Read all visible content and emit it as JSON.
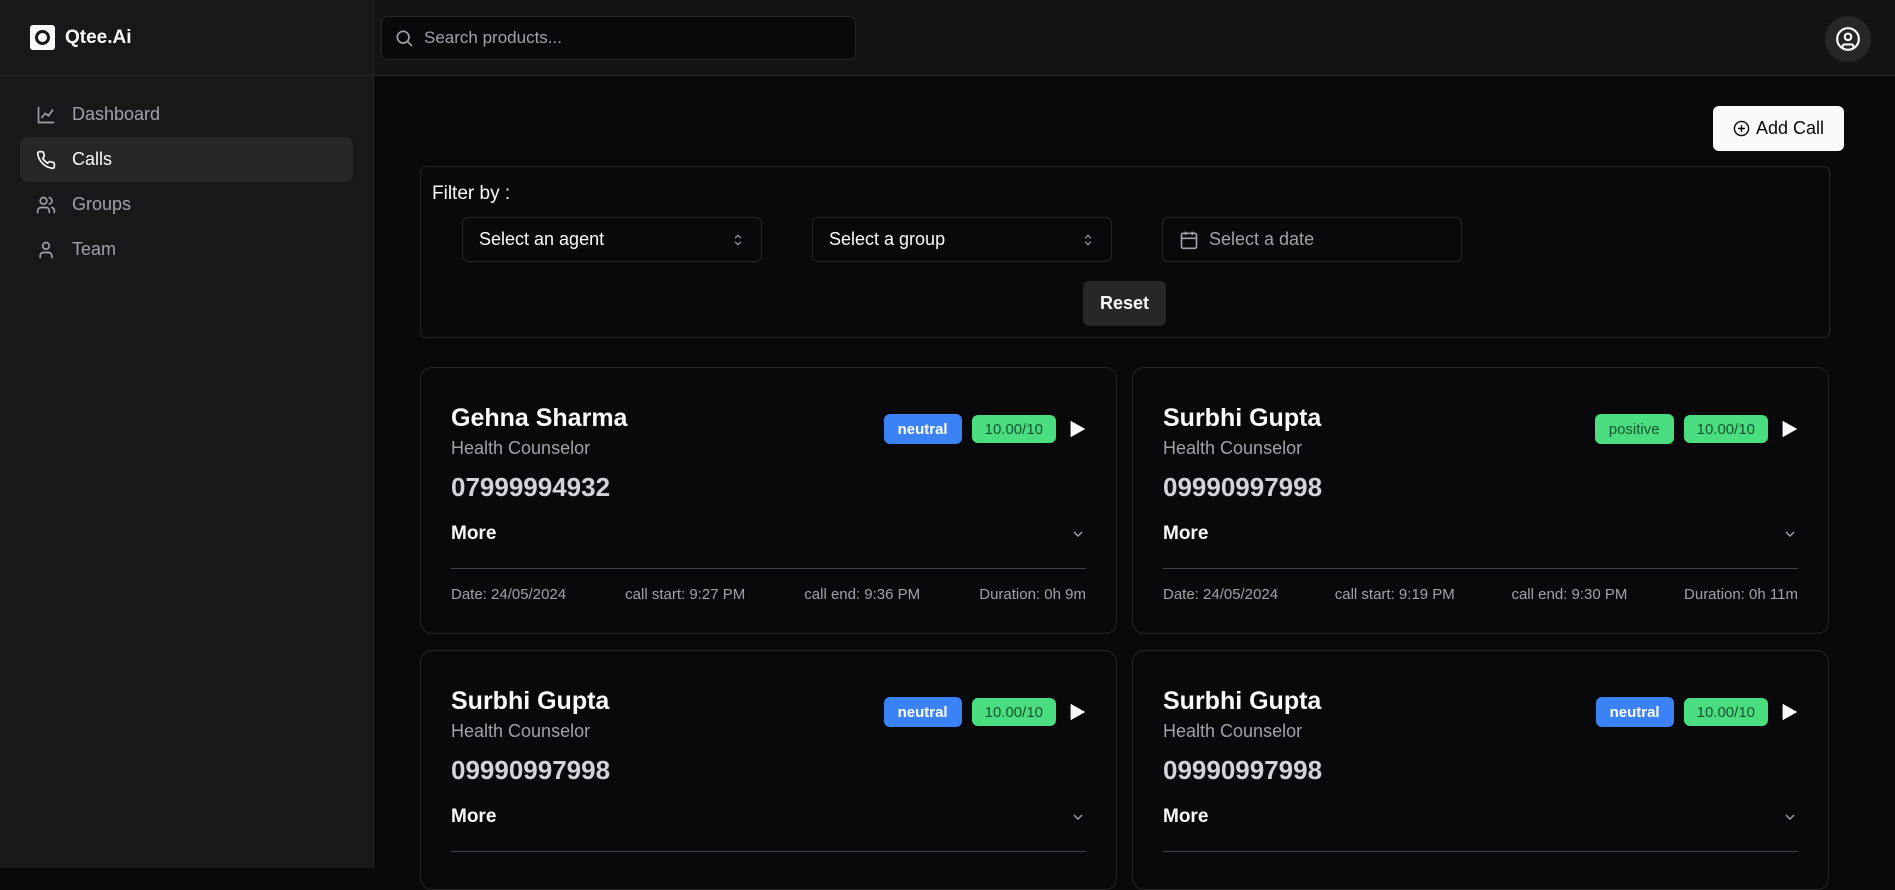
{
  "brand": {
    "name": "Qtee.Ai"
  },
  "sidebar": {
    "items": [
      {
        "label": "Dashboard",
        "icon": "chart-line-icon"
      },
      {
        "label": "Calls",
        "icon": "phone-icon"
      },
      {
        "label": "Groups",
        "icon": "users-icon"
      },
      {
        "label": "Team",
        "icon": "user-icon"
      }
    ],
    "active": "Calls"
  },
  "topbar": {
    "search_placeholder": "Search products...",
    "user_icon": "user-circle-icon"
  },
  "toolbar": {
    "add_call_label": "Add Call"
  },
  "filter": {
    "label": "Filter by :",
    "agent_placeholder": "Select an agent",
    "group_placeholder": "Select a group",
    "date_placeholder": "Select a date",
    "reset_label": "Reset"
  },
  "calls": [
    {
      "name": "Gehna Sharma",
      "role": "Health Counselor",
      "phone": "07999994932",
      "sentiment": "neutral",
      "score": "10.00/10",
      "more": "More",
      "date": "Date: 24/05/2024",
      "start": "call start: 9:27 PM",
      "end": "call end: 9:36 PM",
      "duration": "Duration: 0h 9m"
    },
    {
      "name": "Surbhi Gupta",
      "role": "Health Counselor",
      "phone": "09990997998",
      "sentiment": "positive",
      "score": "10.00/10",
      "more": "More",
      "date": "Date: 24/05/2024",
      "start": "call start: 9:19 PM",
      "end": "call end: 9:30 PM",
      "duration": "Duration: 0h 11m"
    },
    {
      "name": "Surbhi Gupta",
      "role": "Health Counselor",
      "phone": "09990997998",
      "sentiment": "neutral",
      "score": "10.00/10",
      "more": "More"
    },
    {
      "name": "Surbhi Gupta",
      "role": "Health Counselor",
      "phone": "09990997998",
      "sentiment": "neutral",
      "score": "10.00/10",
      "more": "More"
    }
  ],
  "colors": {
    "neutral": "#3b82f6",
    "positive": "#4ade80",
    "score": "#4ade80",
    "background": "#09090b"
  }
}
